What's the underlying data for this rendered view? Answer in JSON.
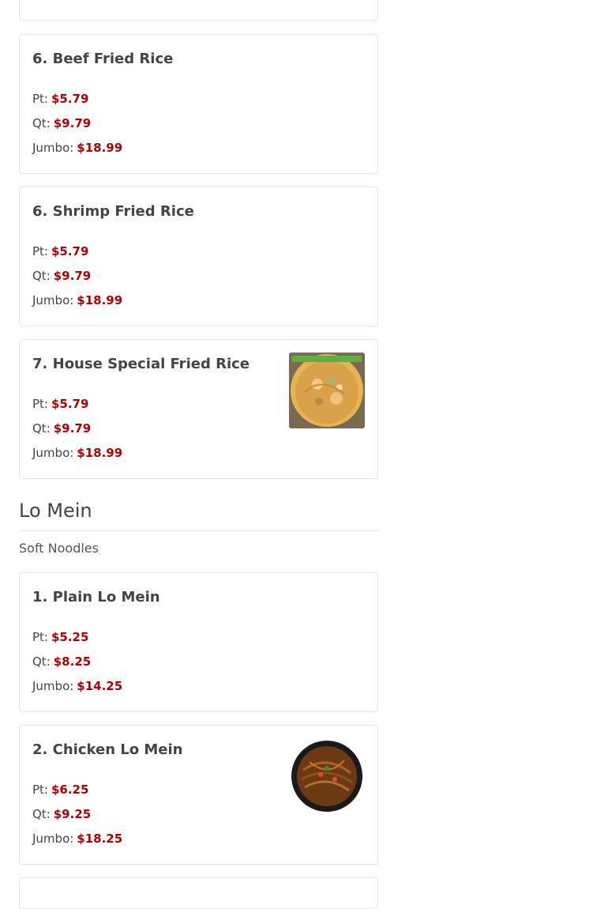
{
  "items_top": [
    {
      "title": "6. Beef Fried Rice",
      "prices": [
        {
          "size": "Pt:",
          "price": "$5.79"
        },
        {
          "size": "Qt:",
          "price": "$9.79"
        },
        {
          "size": "Jumbo:",
          "price": "$18.99"
        }
      ]
    },
    {
      "title": "6. Shrimp Fried Rice",
      "prices": [
        {
          "size": "Pt:",
          "price": "$5.79"
        },
        {
          "size": "Qt:",
          "price": "$9.79"
        },
        {
          "size": "Jumbo:",
          "price": "$18.99"
        }
      ]
    },
    {
      "title": "7. House Special Fried Rice",
      "image": "house-special-fried-rice-photo",
      "prices": [
        {
          "size": "Pt:",
          "price": "$5.79"
        },
        {
          "size": "Qt:",
          "price": "$9.79"
        },
        {
          "size": "Jumbo:",
          "price": "$18.99"
        }
      ]
    }
  ],
  "section": {
    "title": "Lo Mein",
    "subtitle": "Soft Noodles"
  },
  "items_bottom": [
    {
      "title": "1. Plain Lo Mein",
      "prices": [
        {
          "size": "Pt:",
          "price": "$5.25"
        },
        {
          "size": "Qt:",
          "price": "$8.25"
        },
        {
          "size": "Jumbo:",
          "price": "$14.25"
        }
      ]
    },
    {
      "title": "2. Chicken Lo Mein",
      "image": "chicken-lo-mein-photo",
      "prices": [
        {
          "size": "Pt:",
          "price": "$6.25"
        },
        {
          "size": "Qt:",
          "price": "$9.25"
        },
        {
          "size": "Jumbo:",
          "price": "$18.25"
        }
      ]
    }
  ],
  "colors": {
    "price": "#b30000",
    "border": "#e5e5e5",
    "text": "#444444"
  }
}
